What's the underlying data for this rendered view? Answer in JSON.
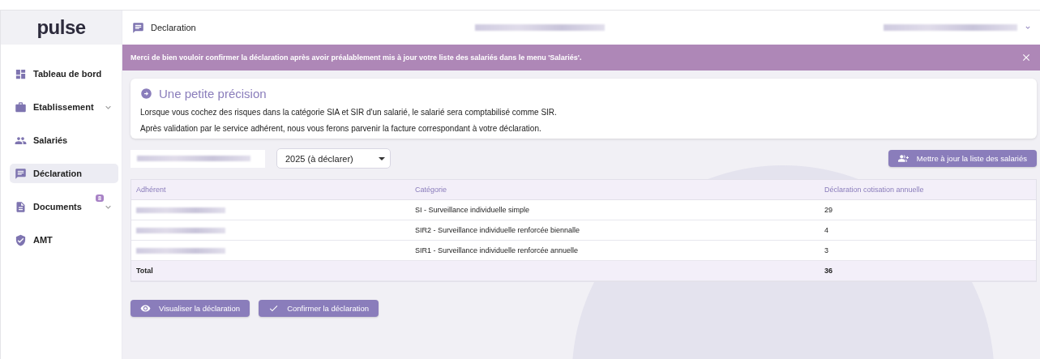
{
  "logo": "pulse",
  "sidebar": {
    "items": [
      {
        "label": "Tableau de bord",
        "kind": "link",
        "selected": false
      },
      {
        "label": "Etablissement",
        "kind": "group",
        "selected": false
      },
      {
        "label": "Salariés",
        "kind": "link",
        "selected": false
      },
      {
        "label": "Déclaration",
        "kind": "link",
        "selected": true
      },
      {
        "label": "Documents",
        "kind": "group",
        "selected": false,
        "badge": "8"
      },
      {
        "label": "AMT",
        "kind": "link",
        "selected": false
      }
    ]
  },
  "header": {
    "title": "Declaration"
  },
  "banner": {
    "message": "Merci de bien vouloir confirmer la déclaration après avoir préalablement mis à jour votre liste des salariés dans le menu 'Salariés'."
  },
  "info_card": {
    "title": "Une petite précision",
    "lines": [
      "Lorsque vous cochez des risques dans la catégorie SIA et SIR d'un salarié, le salarié sera comptabilisé comme SIR.",
      "Après validation par le service adhérent, nous vous ferons parvenir la facture correspondant à votre déclaration."
    ]
  },
  "year_select": {
    "value": "2025 (à déclarer)"
  },
  "update_button": {
    "label": "Mettre à jour la liste des salariés"
  },
  "table": {
    "columns": [
      "Adhérent",
      "Catégorie",
      "Déclaration cotisation annuelle"
    ],
    "rows": [
      {
        "category": "SI - Surveillance individuelle simple",
        "count": "29"
      },
      {
        "category": "SIR2 - Surveillance individuelle renforcée biennalle",
        "count": "4"
      },
      {
        "category": "SIR1 - Surveillance individuelle renforcée annuelle",
        "count": "3"
      }
    ],
    "total": {
      "label": "Total",
      "count": "36"
    }
  },
  "actions": [
    {
      "label": "Visualiser la déclaration"
    },
    {
      "label": "Confirmer la déclaration"
    }
  ]
}
